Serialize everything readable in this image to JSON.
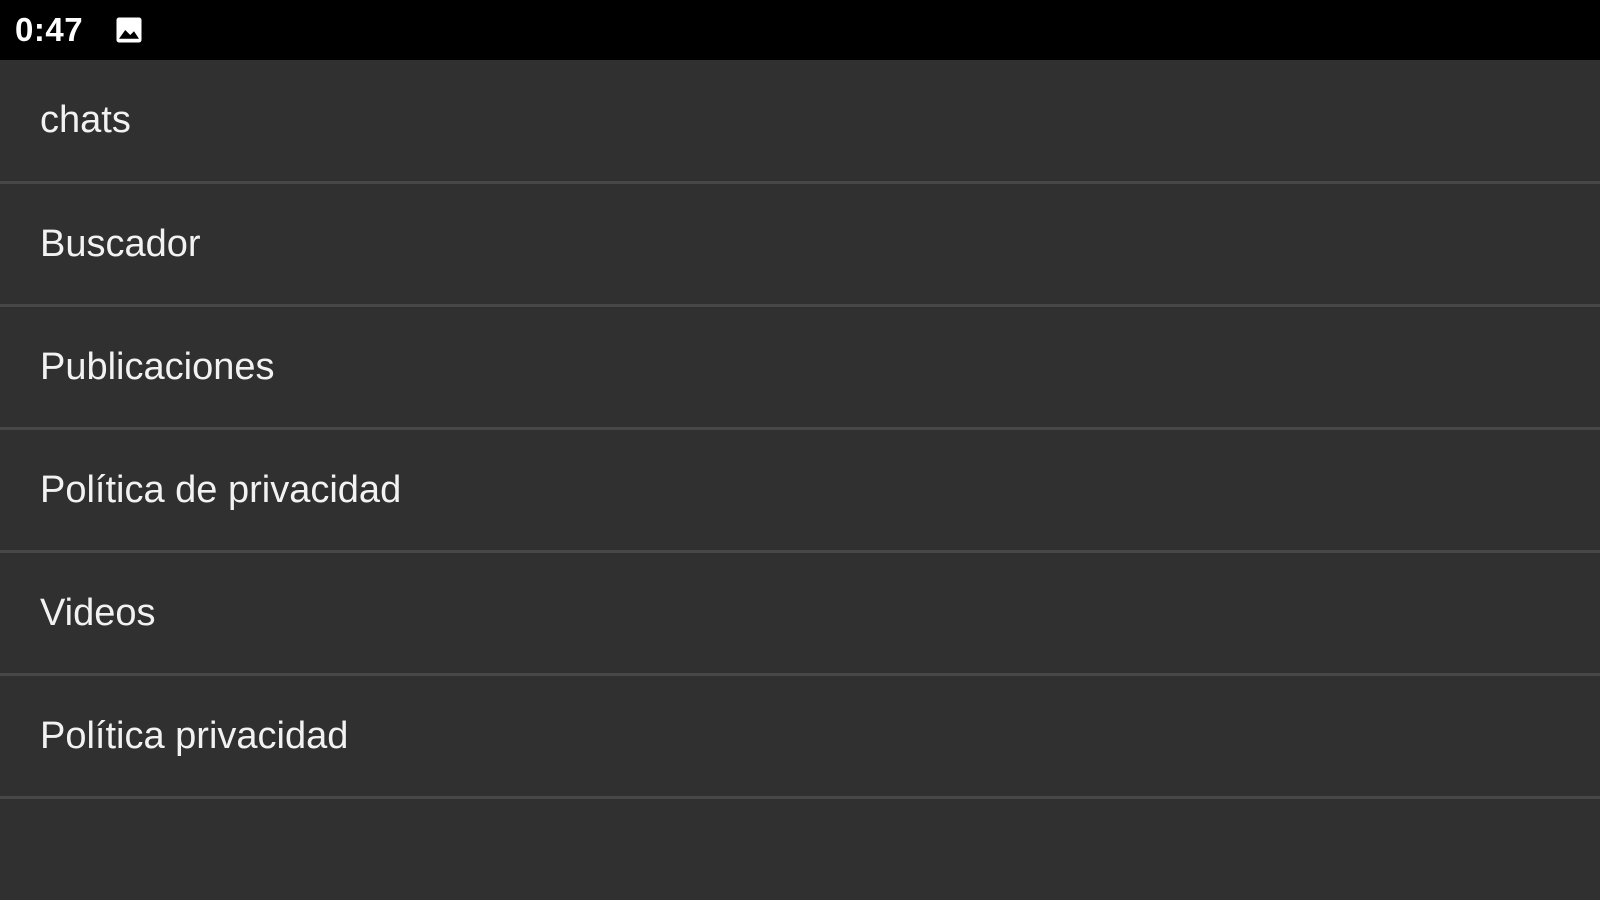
{
  "status_bar": {
    "time": "0:47",
    "notification_icon": "image-icon"
  },
  "menu": {
    "items": [
      {
        "label": "chats"
      },
      {
        "label": "Buscador"
      },
      {
        "label": "Publicaciones"
      },
      {
        "label": "Política de privacidad"
      },
      {
        "label": "Videos"
      },
      {
        "label": "Política privacidad"
      }
    ]
  },
  "colors": {
    "status_bar_bg": "#000000",
    "list_bg": "#303030",
    "divider": "#474747",
    "text": "#f2f2f2"
  }
}
